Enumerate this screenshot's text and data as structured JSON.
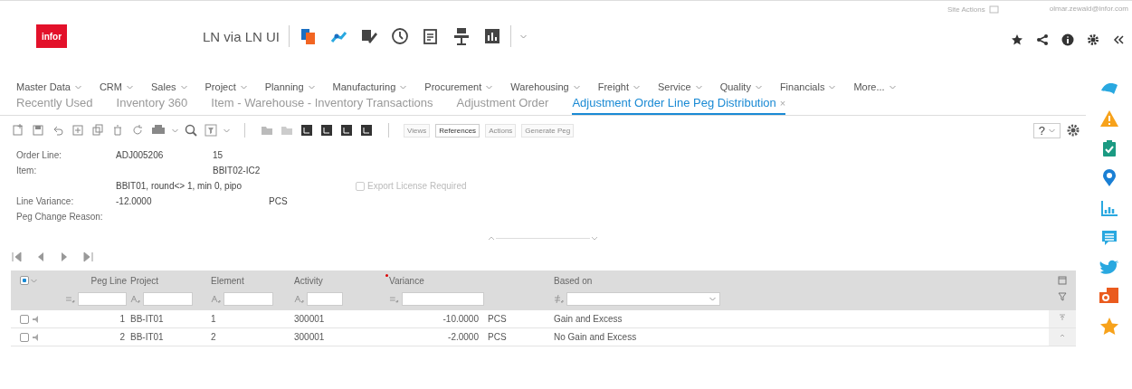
{
  "header": {
    "logo": "infor",
    "app_title": "LN via LN UI",
    "site_actions": "Site Actions",
    "user": "olmar.zewald@infor.com"
  },
  "menu": [
    "Master Data",
    "CRM",
    "Sales",
    "Project",
    "Planning",
    "Manufacturing",
    "Procurement",
    "Warehousing",
    "Freight",
    "Service",
    "Quality",
    "Financials",
    "More..."
  ],
  "tabs": [
    {
      "label": "Recently Used",
      "selected": false
    },
    {
      "label": "Inventory 360",
      "selected": false
    },
    {
      "label": "Item - Warehouse - Inventory Transactions",
      "selected": false
    },
    {
      "label": "Adjustment Order",
      "selected": false
    },
    {
      "label": "Adjustment Order Line Peg Distribution",
      "selected": true,
      "close": "×"
    }
  ],
  "toolbar": {
    "buttons": [
      {
        "label": "Views",
        "disabled": true
      },
      {
        "label": "References",
        "disabled": false
      },
      {
        "label": "Actions",
        "disabled": true
      },
      {
        "label": "Generate Peg",
        "disabled": true
      }
    ],
    "help": "?"
  },
  "form": {
    "order_line": {
      "label": "Order Line:",
      "order": "ADJ005206",
      "line": "15"
    },
    "item": {
      "label": "Item:",
      "code": "BBIT02-IC2",
      "description": "BBIT01, round<> 1, min 0, pipo"
    },
    "export_license": {
      "label": "Export License Required",
      "checked": false,
      "disabled": true
    },
    "line_variance": {
      "label": "Line Variance:",
      "value": "-12.0000",
      "unit": "PCS"
    },
    "peg_change_reason": {
      "label": "Peg Change Reason:"
    }
  },
  "grid": {
    "header_checkbox": {
      "checked": true
    },
    "columns": [
      {
        "label": "Peg Line",
        "required": false,
        "kind": "number"
      },
      {
        "label": "Project",
        "required": false,
        "kind": "text"
      },
      {
        "label": "Element",
        "required": false,
        "kind": "text"
      },
      {
        "label": "Activity",
        "required": false,
        "kind": "text"
      },
      {
        "label": "Variance",
        "required": true,
        "kind": "number"
      },
      {
        "label": "Based on",
        "required": false,
        "kind": "dropdown"
      }
    ],
    "rows": [
      {
        "checked": false,
        "peg_line": "1",
        "project": "BB-IT01",
        "element": "1",
        "activity": "300001",
        "variance": "-10.0000",
        "unit": "PCS",
        "based_on": "Gain and Excess"
      },
      {
        "checked": false,
        "peg_line": "2",
        "project": "BB-IT01",
        "element": "2",
        "activity": "300001",
        "variance": "-2.0000",
        "unit": "PCS",
        "based_on": "No Gain and Excess"
      }
    ]
  }
}
